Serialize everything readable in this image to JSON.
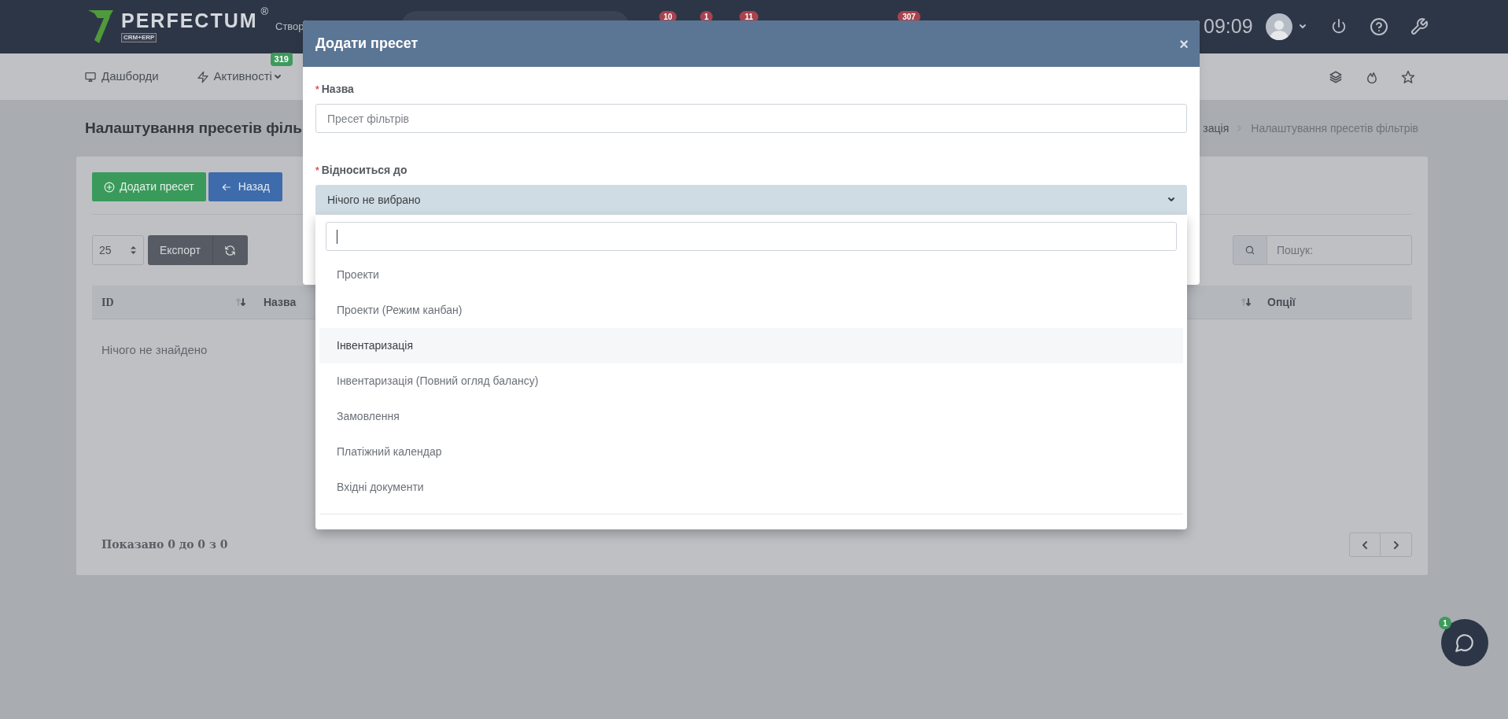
{
  "header": {
    "logo": {
      "name": "PERFECTUM",
      "mark": "®",
      "sub": "CRM+ERP"
    },
    "create_label": "Створ",
    "badges": [
      "10",
      "1",
      "11",
      "307"
    ],
    "time": "09:09"
  },
  "nav": [
    {
      "label": "Дашборди",
      "dropdown": false
    },
    {
      "label": "Активності",
      "badge": "319",
      "dropdown": true
    }
  ],
  "page": {
    "title": "Налаштування пресетів філь",
    "breadcrumb": [
      "зація",
      "Налаштування пресетів фільтрів"
    ]
  },
  "toolbar": {
    "add_button": "Додати пресет",
    "back_button": "Назад",
    "page_size": "25",
    "export_button": "Експорт",
    "search_placeholder": "Пошук:"
  },
  "table": {
    "columns": [
      "ID",
      "Назва",
      "Опції"
    ],
    "empty_text": "Нічого не знайдено",
    "info": "Показано 0 до 0 з 0"
  },
  "chat": {
    "badge": "1"
  },
  "modal": {
    "title": "Додати пресет",
    "close": "×",
    "fields": [
      {
        "label": "Назва",
        "required_mark": "*",
        "kind": "text",
        "placeholder": "Пресет фільтрів"
      },
      {
        "label": "Відноситься до",
        "required_mark": "*",
        "kind": "select",
        "value": "Нічого не вибрано",
        "expanded": true
      }
    ],
    "dropdown_items": [
      {
        "label": "Проекти",
        "highlighted": false
      },
      {
        "label": "Проекти (Режим канбан)",
        "highlighted": false
      },
      {
        "label": "Інвентаризація",
        "highlighted": true
      },
      {
        "label": "Інвентаризація (Повний огляд балансу)",
        "highlighted": false
      },
      {
        "label": "Замовлення",
        "highlighted": false
      },
      {
        "label": "Платіжний календар",
        "highlighted": false
      },
      {
        "label": "Вхідні документи",
        "highlighted": false
      }
    ]
  }
}
